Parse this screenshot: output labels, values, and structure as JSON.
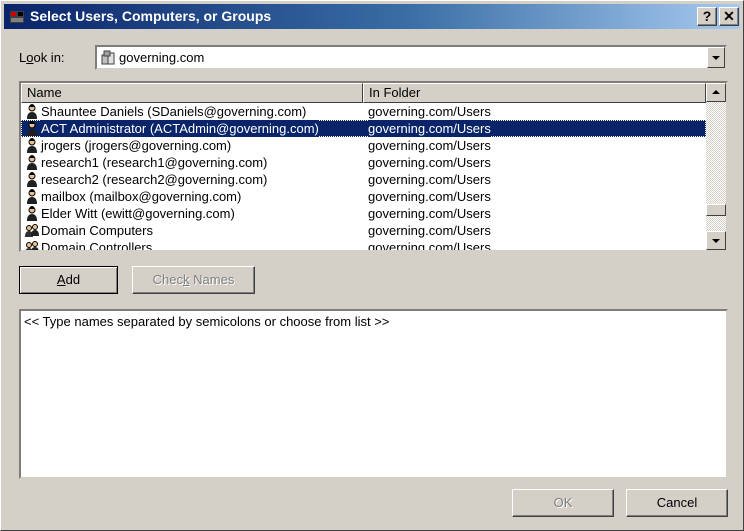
{
  "window": {
    "title": "Select Users, Computers, or Groups",
    "help_glyph": "?",
    "close_glyph": "✕"
  },
  "look_in": {
    "label_prefix": "L",
    "label_ul": "o",
    "label_suffix": "ok in:",
    "value": "governing.com",
    "icon": "domain-icon"
  },
  "list": {
    "columns": [
      "Name",
      "In Folder"
    ],
    "rows": [
      {
        "name": "Shauntee Daniels (SDaniels@governing.com)",
        "folder": "governing.com/Users",
        "icon": "user-icon",
        "selected": false
      },
      {
        "name": "ACT Administrator (ACTAdmin@governing.com)",
        "folder": "governing.com/Users",
        "icon": "user-icon",
        "selected": true
      },
      {
        "name": "jrogers (jrogers@governing.com)",
        "folder": "governing.com/Users",
        "icon": "user-icon",
        "selected": false
      },
      {
        "name": "research1 (research1@governing.com)",
        "folder": "governing.com/Users",
        "icon": "user-icon",
        "selected": false
      },
      {
        "name": "research2 (research2@governing.com)",
        "folder": "governing.com/Users",
        "icon": "user-icon",
        "selected": false
      },
      {
        "name": "mailbox (mailbox@governing.com)",
        "folder": "governing.com/Users",
        "icon": "user-icon",
        "selected": false
      },
      {
        "name": "Elder Witt (ewitt@governing.com)",
        "folder": "governing.com/Users",
        "icon": "user-icon",
        "selected": false
      },
      {
        "name": "Domain Computers",
        "folder": "governing.com/Users",
        "icon": "group-icon",
        "selected": false
      },
      {
        "name": "Domain Controllers",
        "folder": "governing.com/Users",
        "icon": "group-icon",
        "selected": false
      }
    ]
  },
  "buttons": {
    "add_ul": "A",
    "add_rest": "dd",
    "check_pre": "Chec",
    "check_ul": "k",
    "check_post": " Names",
    "ok": "OK",
    "cancel": "Cancel"
  },
  "names_box": {
    "placeholder": "<< Type names separated by semicolons or choose from list >>"
  },
  "colors": {
    "title_start": "#0a246a",
    "title_end": "#a6caf0",
    "selection": "#0a246a",
    "face": "#d4d0c8"
  }
}
